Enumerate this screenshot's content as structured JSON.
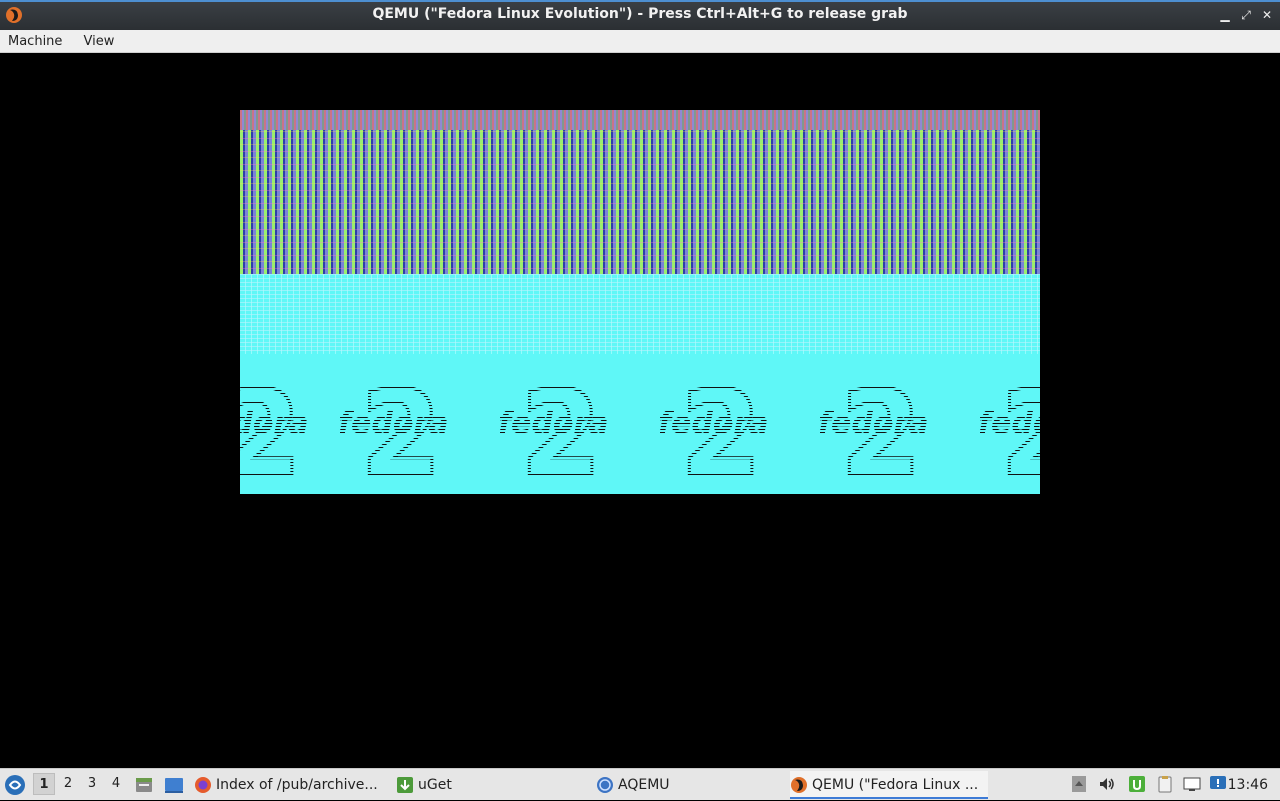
{
  "window": {
    "title": "QEMU (\"Fedora Linux Evolution\") - Press Ctrl+Alt+G to release grab",
    "minimize_glyph": "▁",
    "maximize_glyph": "⤢",
    "close_glyph": "✕"
  },
  "menubar": {
    "items": [
      "Machine",
      "View"
    ]
  },
  "guest_screen": {
    "logo_text": "fedora",
    "logo_numeral": "2"
  },
  "taskbar": {
    "workspaces": [
      "1",
      "2",
      "3",
      "4"
    ],
    "active_workspace": "1",
    "tasks": [
      {
        "label": "Index of /pub/archive...",
        "icon": "firefox-icon"
      },
      {
        "label": "uGet",
        "icon": "uget-icon"
      },
      {
        "label": "AQEMU",
        "icon": "aqemu-icon"
      },
      {
        "label": "QEMU (\"Fedora Linux ...",
        "icon": "qemu-icon",
        "active": true
      }
    ],
    "clock": "13:46"
  },
  "colors": {
    "titlebar": "#2f3337",
    "titlebar_accent": "#4d8fd1",
    "menubar": "#efefef",
    "guest_background": "#000000",
    "guest_cyan": "#5ff7f7",
    "taskbar": "#e6e6e6"
  }
}
